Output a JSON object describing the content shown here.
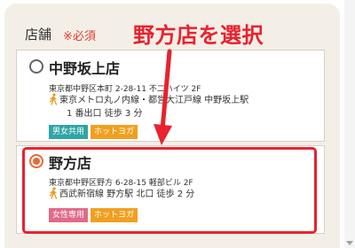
{
  "form": {
    "section_label": "店舗",
    "required_mark": "※必須"
  },
  "annotation": {
    "callout": "野方店を選択",
    "color": "#e8222f"
  },
  "shops": [
    {
      "name": "中野坂上店",
      "address": "東京都中野区本町 2-28-11 不二ハイツ 2F",
      "access_line1": "東京メトロ丸ノ内線・都営大江戸線 中野坂上駅",
      "access_line2": "1 番出口 徒歩 3 分",
      "tags": [
        "男女共用",
        "ホットヨガ"
      ],
      "selected": false
    },
    {
      "name": "野方店",
      "address": "東京都中野区野方 6-28-15 軽部ビル 2F",
      "access_line1": "西武新宿線 野方駅 北口 徒歩 2 分",
      "tags": [
        "女性専用",
        "ホットヨガ"
      ],
      "selected": true
    }
  ],
  "icons": {
    "access": "walking-person-icon",
    "radio": "radio-button-icon"
  },
  "colors": {
    "background": "#f4efe6",
    "radio_selected": "#e86a35",
    "tag_mixed": "#2fa5a5",
    "tag_hot": "#f0a020",
    "tag_women": "#e06a8a"
  }
}
